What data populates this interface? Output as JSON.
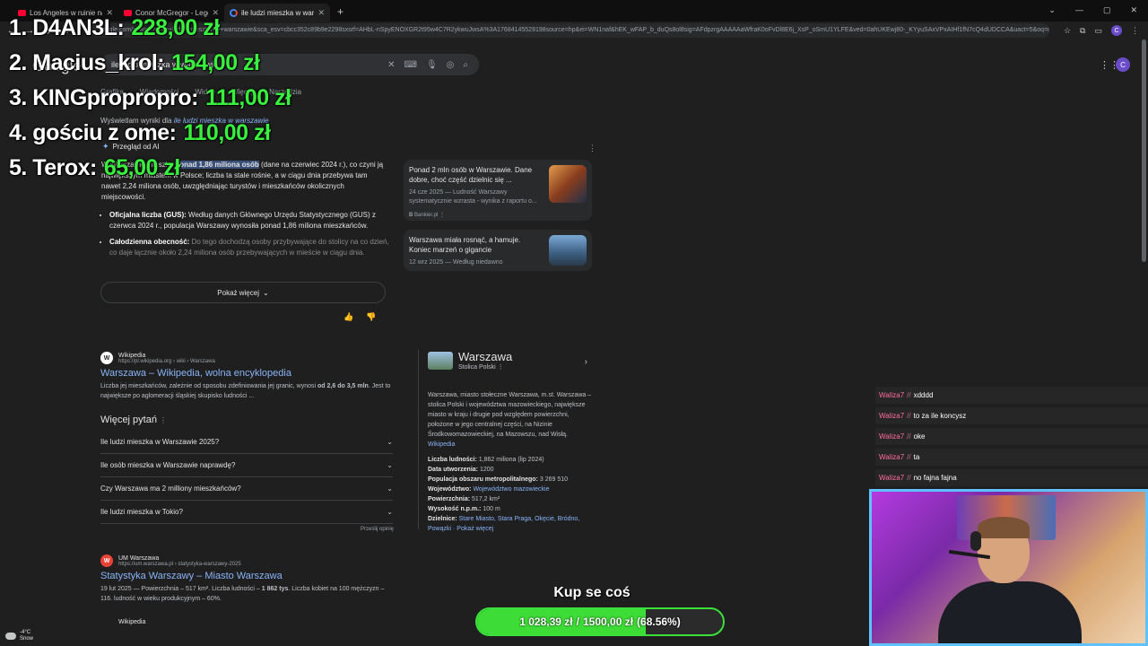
{
  "browser": {
    "tabs": [
      {
        "label": "Los Angeles w ruinie na żywo - W...",
        "icon": "youtube"
      },
      {
        "label": "Conor McGregor - Legendary ...",
        "icon": "youtube"
      },
      {
        "label": "ile ludzi mieszka w warszawie - ...",
        "icon": "google",
        "active": true
      }
    ],
    "url": "google.com/search?q=ile+ludzi+mieszka+w+warszawie&sca_esv=cbcc352c89b9e2298sxsrf=AHbL-nSpyENOXGR2t95w4C7R2ykwuJwsA%3A17684145528198source=hp&ei=WN1naf&hEK_wFAP_b_duQs8ol8sig=AFdpzrgAAAAAaWfraK0oFvDl8E6j_XsP_oSmU1YLFE&ved=0ahUKEwj80-_KYyuSAxVPxAIHf1fN7cQ4dUDCCA&uact=5&oq=ile+ludzi+mieszka",
    "avatar_letter": "C"
  },
  "search": {
    "logo": "Google",
    "query": "ile ludzi mieszka w warszawie",
    "filters": [
      "Grafika",
      "Wiadomości",
      "Wideo",
      "Więcej",
      "Narzędzia"
    ],
    "showing_prefix": "Wyświetlam wyniki dla",
    "showing_query": "ile ludzi mieszka w warszawie"
  },
  "ai_overview": {
    "heading": "Przegląd od AI",
    "intro_pre": "W Warszawie mieszka",
    "intro_hl": "ponad 1,86 miliona osób",
    "intro_post": "(dane na czerwiec 2024 r.), co czyni ją największym miastem w Polsce; liczba ta stale rośnie, a w ciągu dnia przebywa tam nawet 2,24 miliona osób, uwzględniając turystów i mieszkańców okolicznych miejscowości.",
    "bullets": [
      {
        "bold": "Oficjalna liczba (GUS):",
        "text": "Według danych Głównego Urzędu Statystycznego (GUS) z czerwca 2024 r., populacja Warszawy wynosiła ponad 1,86 miliona mieszkańców."
      },
      {
        "bold": "Całodzienna obecność:",
        "text": "Do tego dochodzą osoby przybywające do stolicy na co dzień, co daje łącznie około 2,24 miliona osób przebywających w mieście w ciągu dnia."
      }
    ],
    "cards": [
      {
        "title": "Ponad 2 mln osób w Warszawie. Dane dobre, choć część dzielnic się ...",
        "meta": "24 cze 2025 — Ludność Warszawy systematycznie wzrasta - wynika z raportu o...",
        "source": "Bankier.pl"
      },
      {
        "title": "Warszawa miała rosnąć, a hamuje. Koniec marzeń o gigancie",
        "meta": "12 wrz 2025 — Według niedawno",
        "source": ""
      }
    ],
    "show_more": "Pokaż więcej"
  },
  "results": [
    {
      "site": "Wikipedia",
      "url": "https://pl.wikipedia.org › wiki › Warszawa",
      "title": "Warszawa – Wikipedia, wolna encyklopedia",
      "snippet_pre": "Liczba jej mieszkańców, zależnie od sposobu zdefiniowania jej granic, wynosi",
      "snippet_bold": "od 2,6 do 3,5 mln",
      "snippet_post": ". Jest to największe po aglomeracji śląskiej skupisko ludności ..."
    },
    {
      "site": "UM Warszawa",
      "url": "https://um.warszawa.pl › statystyka-warszawy-2025",
      "title": "Statystyka Warszawy – Miasto Warszawa",
      "snippet_pre": "19 lut 2025 — Powierzchnia – 517 km². Liczba ludności –",
      "snippet_bold": "1 862 tys",
      "snippet_post": ". Liczba kobiet na 100 mężczyzn – 116. ludność w wieku produkcyjnym – 60%."
    }
  ],
  "next_result_site": "Wikipedia",
  "paa": {
    "heading": "Więcej pytań",
    "questions": [
      "Ile ludzi mieszka w Warszawie 2025?",
      "Ile osób mieszka w Warszawie naprawdę?",
      "Czy Warszawa ma 2 milliony mieszkańców?",
      "Ile ludzi mieszka w Tokio?"
    ],
    "feedback": "Prześlij opinię"
  },
  "knowledge_panel": {
    "title": "Warszawa",
    "subtitle": "Stolica Polski",
    "description": "Warszawa, miasto stołeczne Warszawa, m.st. Warszawa – stolica Polski i województwa mazowieckiego, największe miasto w kraju i drugie pod względem powierzchni, położone w jego centralnej części, na Nizinie Środkowomazowieckiej, na Mazowszu, nad Wisłą.",
    "source": "Wikipedia",
    "facts": [
      {
        "label": "Liczba ludności:",
        "value": "1,862 miliona (lip 2024)",
        "link": false
      },
      {
        "label": "Data utworzenia:",
        "value": "1200",
        "link": false
      },
      {
        "label": "Populacja obszaru metropolitalnego:",
        "value": "3 269 510",
        "link": false
      },
      {
        "label": "Województwo:",
        "value": "Województwo mazowieckie",
        "link": true
      },
      {
        "label": "Powierzchnia:",
        "value": "517,2 km²",
        "link": false
      },
      {
        "label": "Wysokość n.p.m.:",
        "value": "100 m",
        "link": false
      },
      {
        "label": "Dzielnice:",
        "value": "Stare Miasto, Stara Praga, Okęcie, Bródno, Powązki · Pokaż więcej",
        "link": true
      }
    ]
  },
  "ranking": [
    {
      "name": "1. D4AN3L:",
      "amount": "228,00 zł"
    },
    {
      "name": "2. Macius_krol:",
      "amount": "154,00 zł"
    },
    {
      "name": "3. KINGpropropro:",
      "amount": "111,00 zł"
    },
    {
      "name": "4. gościu z ome:",
      "amount": "110,00 zł"
    },
    {
      "name": "5. Terox:",
      "amount": "65,00 zł"
    }
  ],
  "chat": [
    {
      "user": "Waliza7",
      "sep": "//",
      "text": "xdddd"
    },
    {
      "user": "Waliza7",
      "sep": "//",
      "text": "to za ile koncysz"
    },
    {
      "user": "Waliza7",
      "sep": "//",
      "text": "oke"
    },
    {
      "user": "Waliza7",
      "sep": "//",
      "text": "ta"
    },
    {
      "user": "Waliza7",
      "sep": "//",
      "text": "no fajna fajna"
    }
  ],
  "goal": {
    "title": "Kup se coś",
    "current": "1 028,39 zł",
    "sep": "/",
    "target": "1500,00 zł",
    "percent_label": "(68.56%)",
    "progress": 0.6856,
    "color": "#3ddc36"
  },
  "weather": {
    "temp": "-4°C",
    "desc": "Snow"
  }
}
